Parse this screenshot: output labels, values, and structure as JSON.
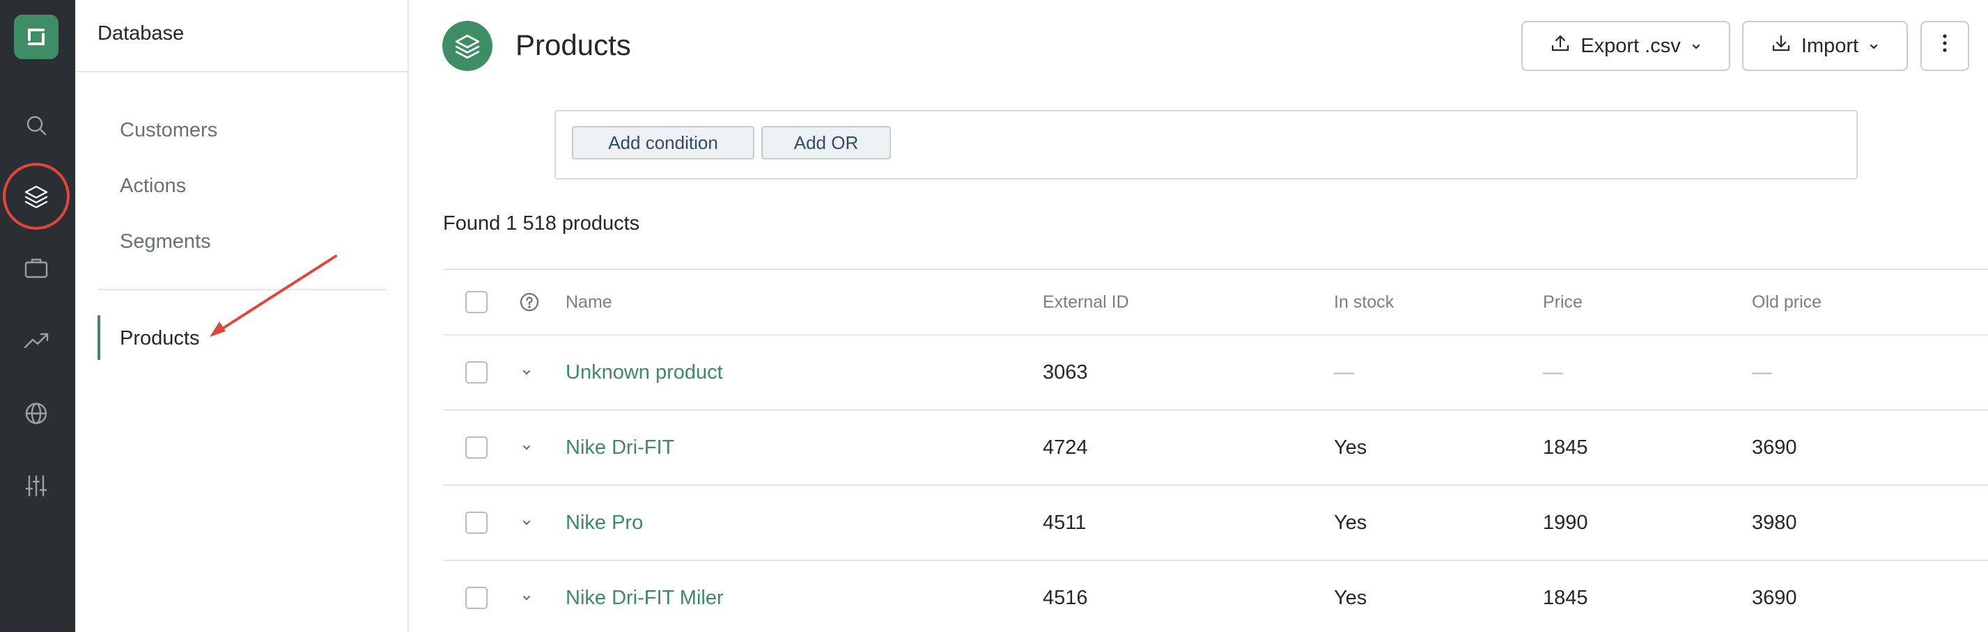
{
  "rail": {
    "icons": [
      "logo-icon",
      "search-icon",
      "layers-icon",
      "briefcase-icon",
      "trending-icon",
      "globe-icon",
      "sliders-icon"
    ]
  },
  "subnav": {
    "title": "Database",
    "items": [
      {
        "label": "Customers"
      },
      {
        "label": "Actions"
      },
      {
        "label": "Segments"
      }
    ],
    "active_item": "Products"
  },
  "page": {
    "title": "Products",
    "export_label": "Export .csv",
    "import_label": "Import"
  },
  "filter": {
    "add_condition": "Add condition",
    "add_or": "Add OR"
  },
  "found_text": "Found 1 518 products",
  "table": {
    "columns": {
      "name": "Name",
      "external_id": "External ID",
      "in_stock": "In stock",
      "price": "Price",
      "old_price": "Old price"
    },
    "rows": [
      {
        "name": "Unknown product",
        "external_id": "3063",
        "in_stock": "—",
        "price": "—",
        "old_price": "—"
      },
      {
        "name": "Nike Dri-FIT",
        "external_id": "4724",
        "in_stock": "Yes",
        "price": "1845",
        "old_price": "3690"
      },
      {
        "name": "Nike Pro",
        "external_id": "4511",
        "in_stock": "Yes",
        "price": "1990",
        "old_price": "3980"
      },
      {
        "name": "Nike Dri-FIT Miler",
        "external_id": "4516",
        "in_stock": "Yes",
        "price": "1845",
        "old_price": "3690"
      }
    ]
  },
  "colors": {
    "accent": "#3f8d64",
    "rail_bg": "#2b2e33",
    "annotation": "#e0483b",
    "link": "#3d8b61"
  }
}
